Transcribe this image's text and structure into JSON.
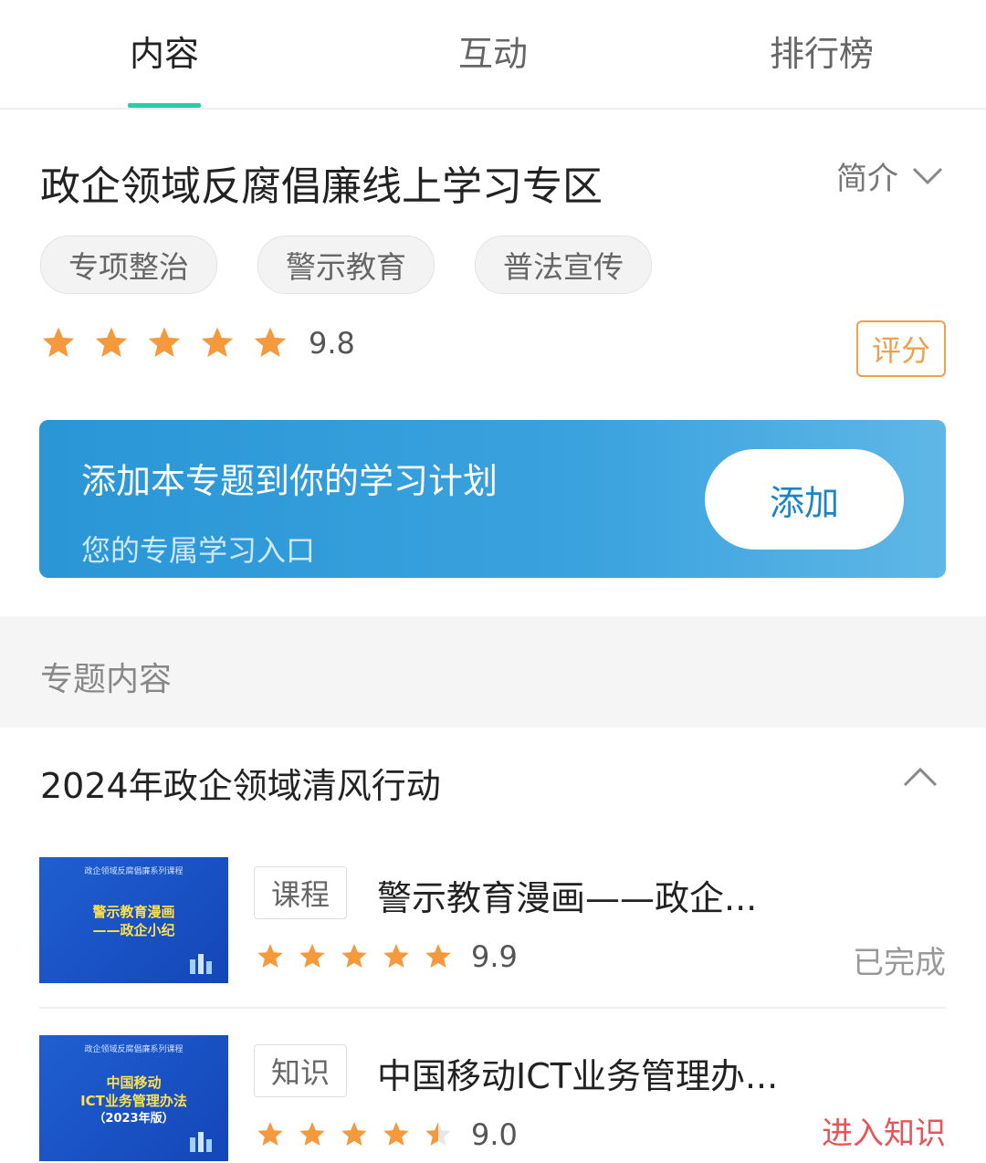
{
  "tabs": [
    {
      "label": "内容",
      "active": true
    },
    {
      "label": "互动",
      "active": false
    },
    {
      "label": "排行榜",
      "active": false
    }
  ],
  "topic": {
    "title": "政企领域反腐倡廉线上学习专区",
    "intro_label": "简介",
    "tags": [
      "专项整治",
      "警示教育",
      "普法宣传"
    ],
    "rating": {
      "stars": 5,
      "score": "9.8"
    },
    "rate_button": "评分"
  },
  "banner": {
    "title": "添加本专题到你的学习计划",
    "subtitle": "您的专属学习入口",
    "add_button": "添加"
  },
  "section": {
    "title": "专题内容"
  },
  "group": {
    "title": "2024年政企领域清风行动",
    "items": [
      {
        "thumb_top": "政企领域反腐倡廉系列课程",
        "thumb_lines": [
          "警示教育漫画",
          "——政企小纪"
        ],
        "badge": "课程",
        "title": "警示教育漫画——政企...",
        "stars": 5,
        "score": "9.9",
        "status": "已完成",
        "status_color": "#999999"
      },
      {
        "thumb_top": "政企领域反腐倡廉系列课程",
        "thumb_lines": [
          "中国移动",
          "ICT业务管理办法",
          "（2023年版）"
        ],
        "badge": "知识",
        "title": "中国移动ICT业务管理办...",
        "stars": 4.5,
        "score": "9.0",
        "status": "进入知识",
        "status_color": "#e5565a"
      }
    ]
  },
  "colors": {
    "accent": "#2ec9a6",
    "star": "#f59a3c",
    "banner": "#2a96d6",
    "rate": "#f0a04b"
  }
}
